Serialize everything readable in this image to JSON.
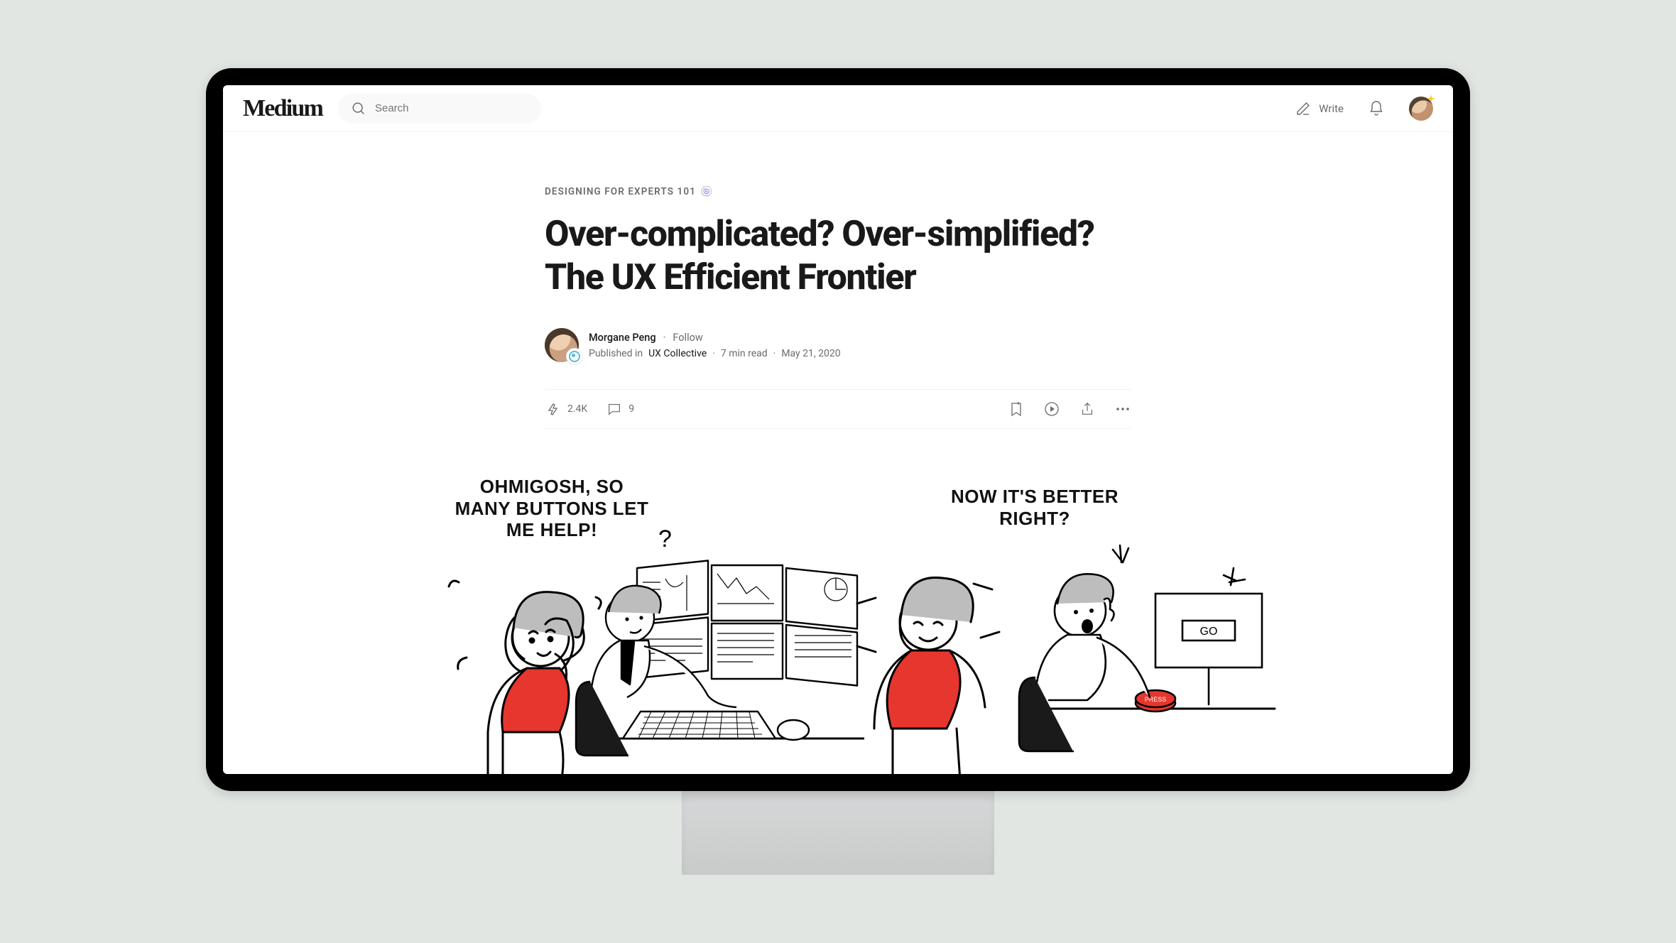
{
  "nav": {
    "logo": "Medium",
    "search_placeholder": "Search",
    "write_label": "Write"
  },
  "article": {
    "kicker": "DESIGNING FOR EXPERTS 101",
    "kicker_emoji": "🍥",
    "title": "Over-complicated? Over-simplified? The UX Efficient Frontier",
    "author": "Morgane Peng",
    "follow": "Follow",
    "published_in_label": "Published in",
    "publication": "UX Collective",
    "read_time": "7 min read",
    "date": "May 21, 2020",
    "claps": "2.4K",
    "responses": "9"
  },
  "illustration": {
    "caption_left": "OHMIGOSH, SO MANY BUTTONS LET ME HELP!",
    "caption_right": "NOW IT'S BETTER RIGHT?",
    "go_label": "GO",
    "press_label": "PRESS"
  }
}
